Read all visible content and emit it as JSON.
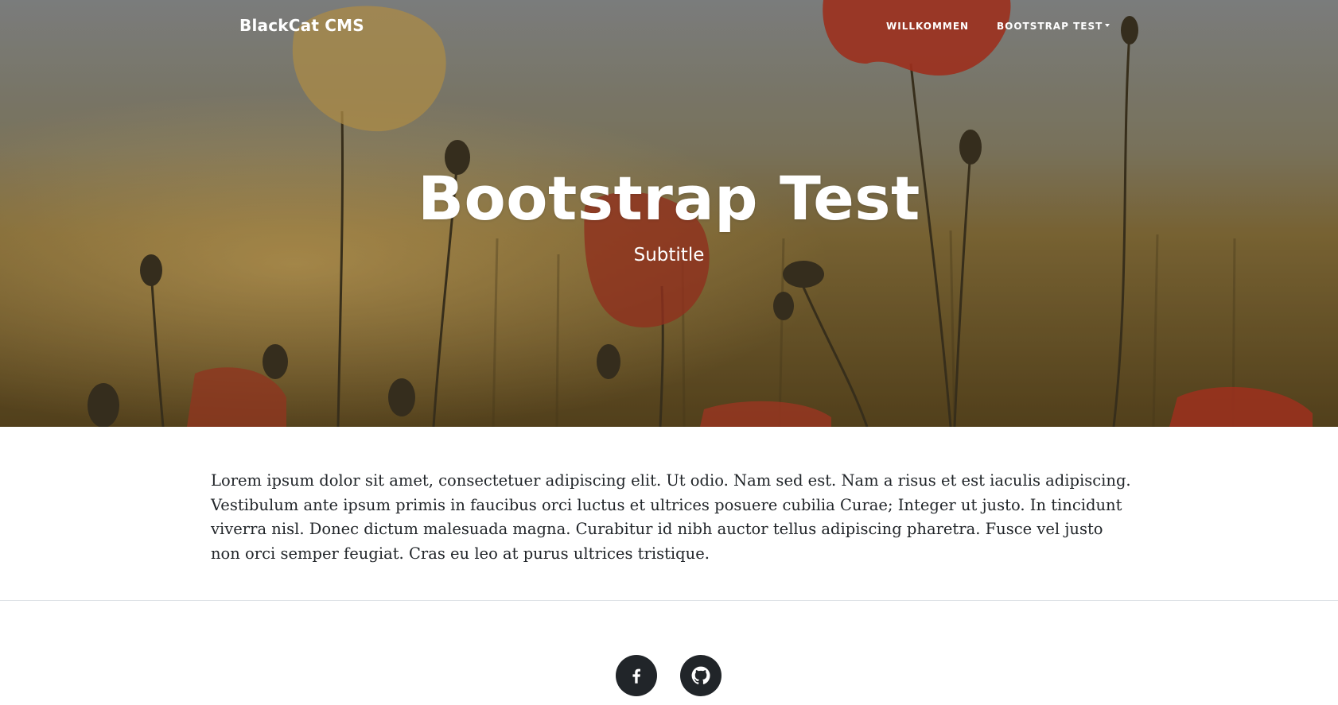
{
  "navbar": {
    "brand": "BlackCat CMS",
    "items": [
      {
        "label": "WILLKOMMEN"
      },
      {
        "label": "BOOTSTRAP TEST",
        "has_dropdown": true
      }
    ]
  },
  "hero": {
    "title": "Bootstrap Test",
    "subtitle": "Subtitle"
  },
  "content": {
    "paragraph": "Lorem ipsum dolor sit amet, consectetuer adipiscing elit. Ut odio. Nam sed est. Nam a risus et est iaculis adipiscing. Vestibulum ante ipsum primis in faucibus orci luctus et ultrices posuere cubilia Curae; Integer ut justo. In tincidunt viverra nisl. Donec dictum malesuada magna. Curabitur id nibh auctor tellus adipiscing pharetra. Fusce vel justo non orci semper feugiat. Cras eu leo at purus ultrices tristique."
  },
  "footer": {
    "social": [
      {
        "icon": "facebook-icon"
      },
      {
        "icon": "github-icon"
      }
    ]
  },
  "colors": {
    "text": "#212529",
    "social_bg": "#212529",
    "divider": "#dee2e6",
    "poppy": "#b8321c"
  }
}
